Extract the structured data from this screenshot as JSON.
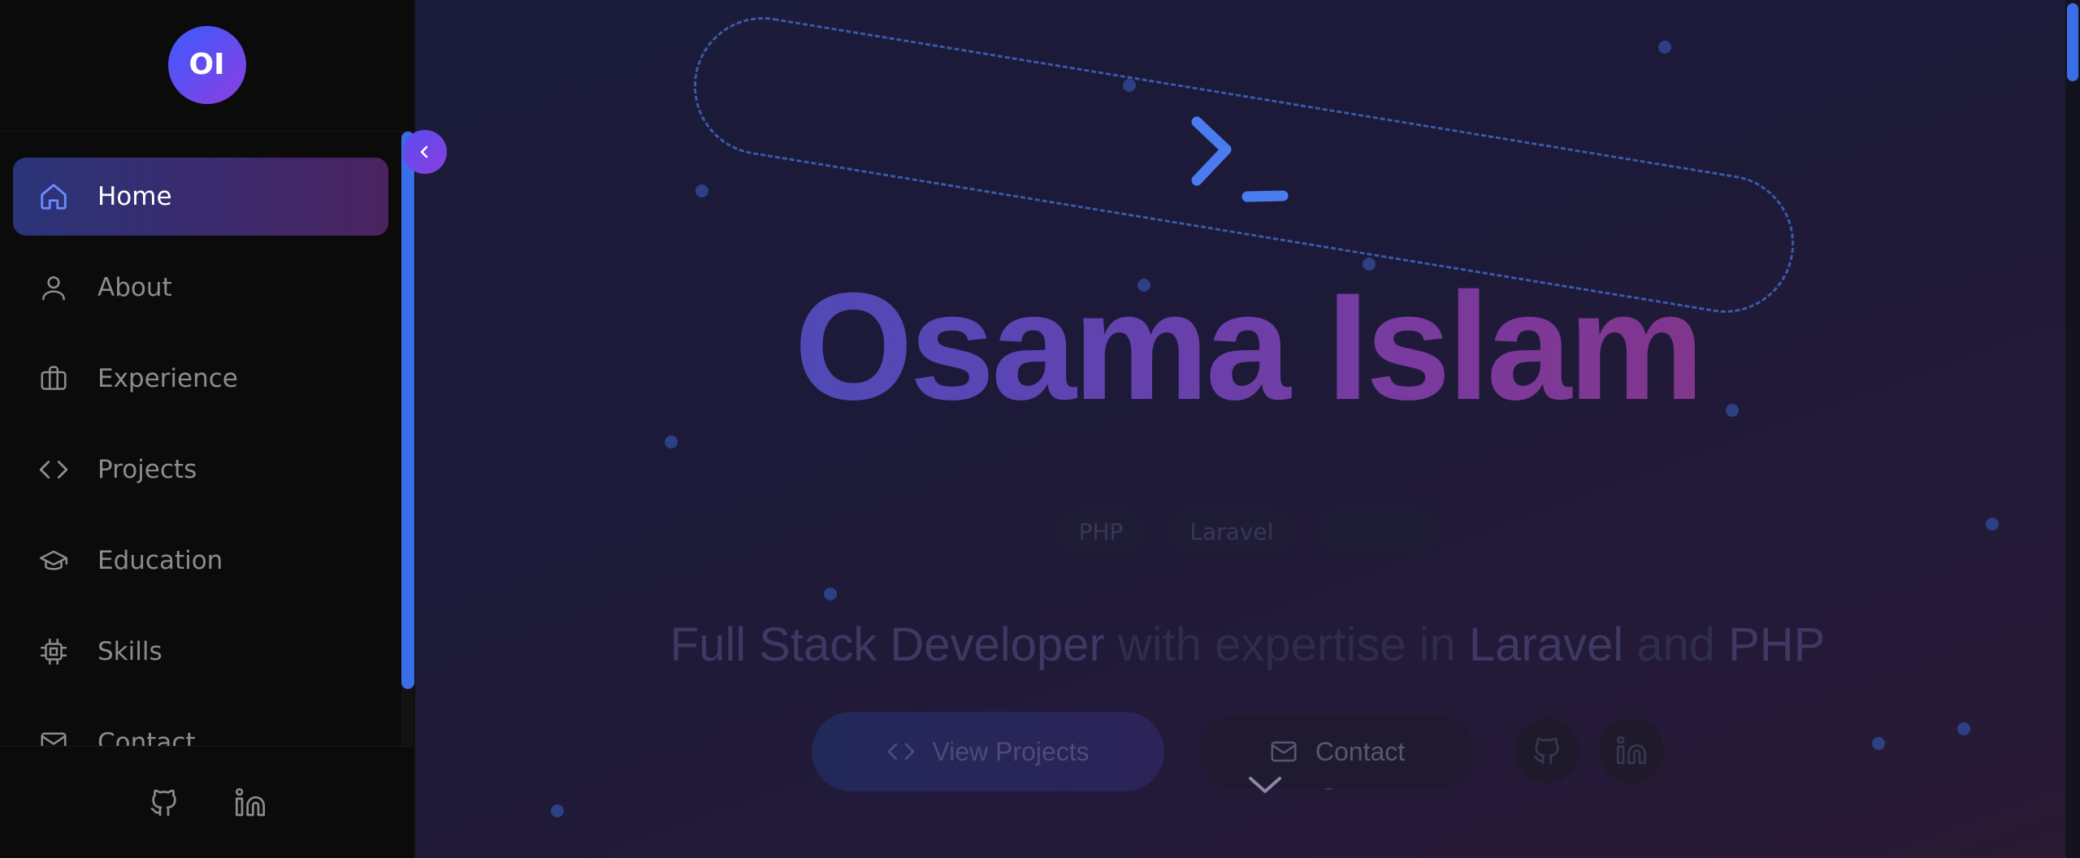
{
  "sidebar": {
    "avatar_initials": "OI",
    "items": [
      {
        "label": "Home",
        "icon": "home-icon",
        "active": true
      },
      {
        "label": "About",
        "icon": "user-icon",
        "active": false
      },
      {
        "label": "Experience",
        "icon": "briefcase-icon",
        "active": false
      },
      {
        "label": "Projects",
        "icon": "code-icon",
        "active": false
      },
      {
        "label": "Education",
        "icon": "graduation-cap-icon",
        "active": false
      },
      {
        "label": "Skills",
        "icon": "cpu-icon",
        "active": false
      },
      {
        "label": "Contact",
        "icon": "mail-icon",
        "active": false
      }
    ],
    "footer_links": [
      "github-icon",
      "linkedin-icon"
    ]
  },
  "hero": {
    "name": "Osama Islam",
    "chips": [
      "PHP",
      "Laravel",
      ""
    ],
    "tagline": {
      "part1": "Full Stack Developer",
      "part2": " with expertise in ",
      "part3": "Laravel",
      "part4": " and ",
      "part5": "PHP"
    },
    "primary_button": "View Projects",
    "secondary_button": "Contact"
  },
  "colors": {
    "accent_blue": "#3a6ee8",
    "accent_purple": "#8b3ee0",
    "sidebar_bg": "#0b0b0b",
    "hero_bg": "#1b1b3a"
  }
}
